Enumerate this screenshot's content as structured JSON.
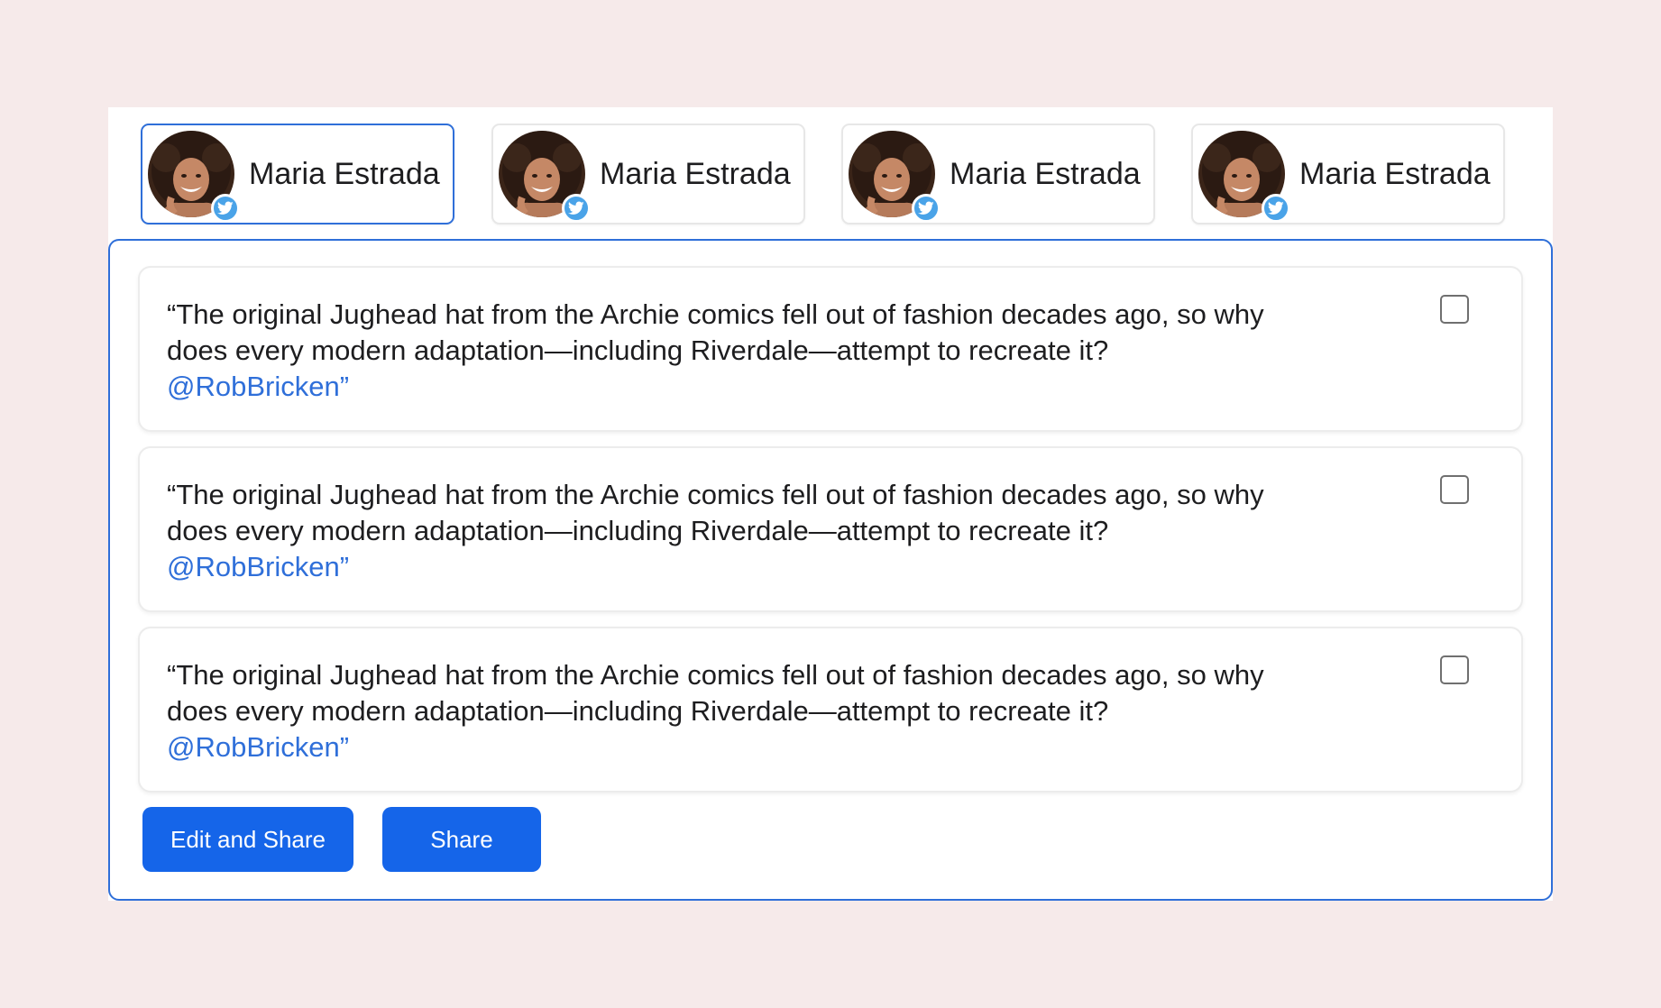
{
  "accounts": [
    {
      "name": "Maria Estrada",
      "network_icon": "twitter-icon",
      "active": true
    },
    {
      "name": "Maria Estrada",
      "network_icon": "twitter-icon",
      "active": false
    },
    {
      "name": "Maria Estrada",
      "network_icon": "twitter-icon",
      "active": false
    },
    {
      "name": "Maria Estrada",
      "network_icon": "twitter-icon",
      "active": false
    }
  ],
  "posts": [
    {
      "text": "“The original Jughead hat from the Archie comics fell out of fashion decades ago, so why does every modern adaptation—including Riverdale—attempt to recreate it?",
      "mention": "@RobBricken",
      "closing_quote": "”",
      "checked": false
    },
    {
      "text": "“The original Jughead hat from the Archie comics fell out of fashion decades ago, so why does every modern adaptation—including Riverdale—attempt to recreate it?",
      "mention": "@RobBricken",
      "closing_quote": "”",
      "checked": false
    },
    {
      "text": "“The original Jughead hat from the Archie comics fell out of fashion decades ago, so why does every modern adaptation—including Riverdale—attempt to recreate it?",
      "mention": "@RobBricken",
      "closing_quote": "”",
      "checked": false
    }
  ],
  "actions": {
    "edit_and_share_label": "Edit and Share",
    "share_label": "Share"
  },
  "colors": {
    "accent": "#2f6fd9",
    "button": "#1565e9",
    "twitter": "#4aa3e8",
    "background": "#f6eaea"
  }
}
